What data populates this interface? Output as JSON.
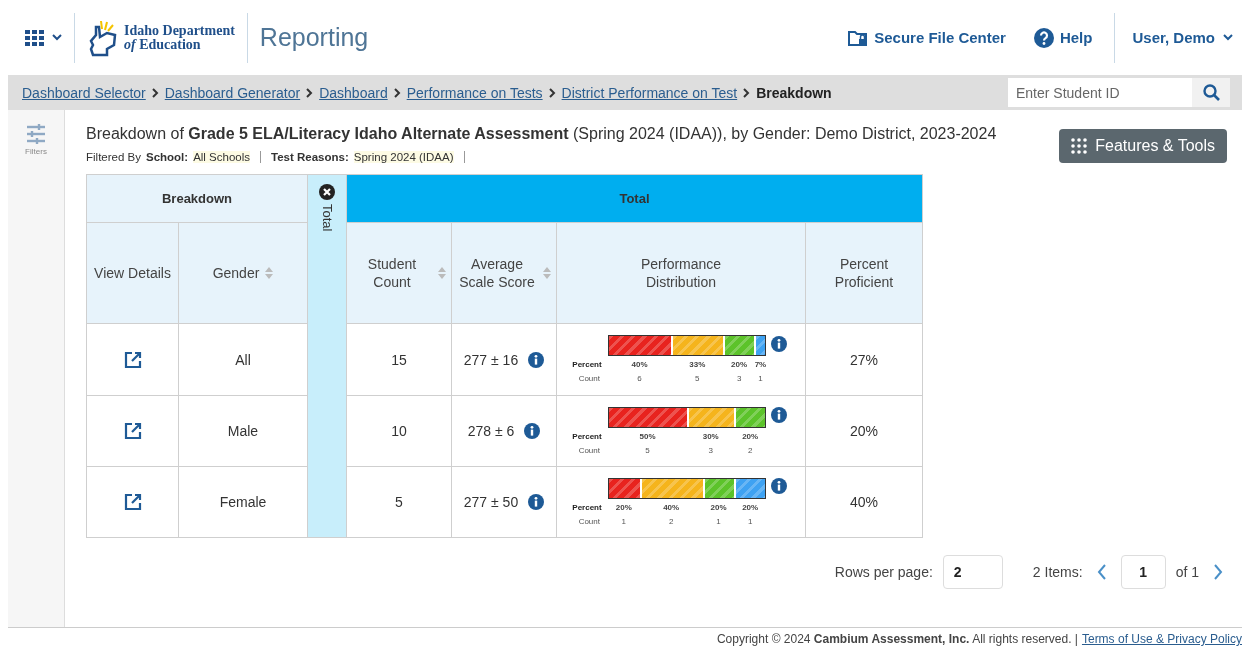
{
  "header": {
    "logo_line_1": "Idaho Department",
    "logo_line_2": "*of* Education",
    "app_name": "Reporting",
    "links": [
      {
        "label": "Secure File Center",
        "kind": "folder"
      },
      {
        "label": "Help",
        "kind": "help"
      }
    ],
    "user": "User, Demo"
  },
  "breadcrumbs": [
    {
      "label": "Dashboard Selector",
      "current": false
    },
    {
      "label": "Dashboard Generator",
      "current": false
    },
    {
      "label": "Dashboard",
      "current": false
    },
    {
      "label": "Performance on Tests",
      "current": false
    },
    {
      "label": "District Performance on Test",
      "current": false
    },
    {
      "label": "Breakdown",
      "current": true
    }
  ],
  "student_search": {
    "placeholder": "Enter Student ID"
  },
  "sidebar": {
    "filters_label": "Filters"
  },
  "report": {
    "title": "Breakdown of **Grade 5 ELA/Literacy Idaho Alternate Assessment** (Spring 2024 (IDAA)), by Gender: Demo District, 2023-2024",
    "filtered_by_label": "Filtered By",
    "filters": [
      {
        "name": "School:",
        "value": "All Schools"
      },
      {
        "name": "Test Reasons:",
        "value": "Spring 2024 (IDAA)"
      }
    ],
    "features_button": "Features & Tools"
  },
  "table": {
    "breakdown_header": "Breakdown",
    "total_header": "Total",
    "total_strip": "Total",
    "columns": [
      {
        "label": "View Details",
        "sortable": false
      },
      {
        "label": "Gender",
        "sortable": true
      },
      {
        "label": "Student Count",
        "sortable": true
      },
      {
        "label": "Average Scale Score",
        "sortable": true
      },
      {
        "label": "Performance Distribution",
        "sortable": false
      },
      {
        "label": "Percent Proficient",
        "sortable": false
      }
    ],
    "rows": [
      {
        "gender": "All",
        "student_count": "15",
        "average_scale_score": "277 ± 16",
        "percent_proficient": "27%",
        "distribution": {
          "percent_label": "Percent",
          "count_label": "Count",
          "segments": [
            {
              "color": "#e8231e",
              "percent": "40%",
              "count": "6"
            },
            {
              "color": "#f5b41c",
              "percent": "33%",
              "count": "5"
            },
            {
              "color": "#5cc32a",
              "percent": "20%",
              "count": "3"
            },
            {
              "color": "#3ea2f2",
              "percent": "7%",
              "count": "1"
            }
          ]
        }
      },
      {
        "gender": "Male",
        "student_count": "10",
        "average_scale_score": "278 ± 6",
        "percent_proficient": "20%",
        "distribution": {
          "percent_label": "Percent",
          "count_label": "Count",
          "segments": [
            {
              "color": "#e8231e",
              "percent": "50%",
              "count": "5"
            },
            {
              "color": "#f5b41c",
              "percent": "30%",
              "count": "3"
            },
            {
              "color": "#5cc32a",
              "percent": "20%",
              "count": "2"
            }
          ]
        }
      },
      {
        "gender": "Female",
        "student_count": "5",
        "average_scale_score": "277 ± 50",
        "percent_proficient": "40%",
        "distribution": {
          "percent_label": "Percent",
          "count_label": "Count",
          "segments": [
            {
              "color": "#e8231e",
              "percent": "20%",
              "count": "1"
            },
            {
              "color": "#f5b41c",
              "percent": "40%",
              "count": "2"
            },
            {
              "color": "#5cc32a",
              "percent": "20%",
              "count": "1"
            },
            {
              "color": "#3ea2f2",
              "percent": "20%",
              "count": "1"
            }
          ]
        }
      }
    ]
  },
  "pager": {
    "rows_per_page_label": "Rows per page:",
    "rows_per_page": "2",
    "items_label": "2 Items:",
    "page": "1",
    "of_label": "of 1"
  },
  "footer": {
    "copyright": "Copyright © 2024 **Cambium Assessment, Inc.** All rights reserved. |",
    "link": "Terms of Use & Privacy Policy"
  }
}
